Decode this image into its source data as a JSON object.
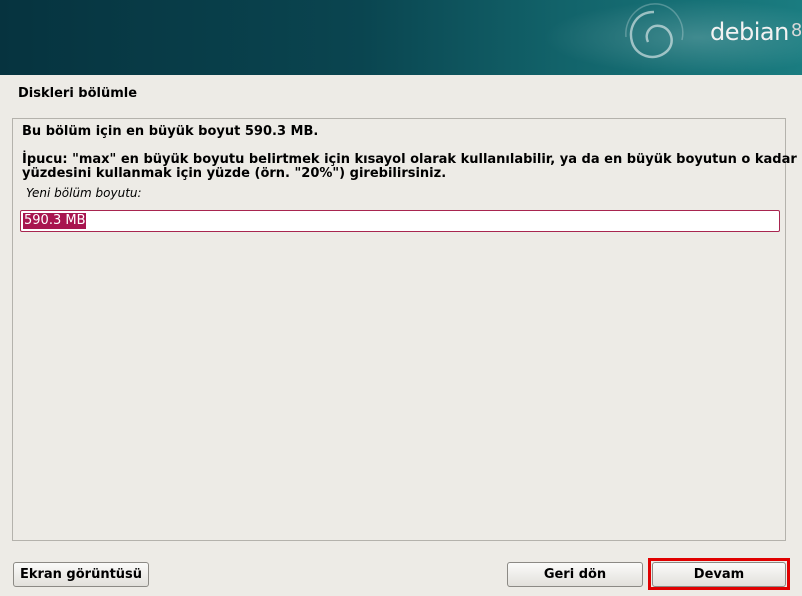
{
  "banner": {
    "logo_text": "debian",
    "logo_version": "8"
  },
  "page": {
    "title": "Diskleri bölümle"
  },
  "panel": {
    "message_size": "Bu bölüm için en büyük boyut 590.3 MB.",
    "message_hint_line1": "İpucu: \"max\" en büyük boyutu belirtmek için kısayol olarak kullanılabilir, ya da en büyük boyutun o kadar",
    "message_hint_line2": "yüzdesini kullanmak için yüzde (örn. \"20%\") girebilirsiniz.",
    "field_label": "Yeni bölüm boyutu:",
    "field_value": "590.3 MB"
  },
  "buttons": {
    "screenshot": "Ekran görüntüsü",
    "back": "Geri dön",
    "continue": "Devam"
  },
  "colors": {
    "selection": "#a8154f",
    "highlight_box": "#e00000",
    "banner": "#0a4550"
  }
}
